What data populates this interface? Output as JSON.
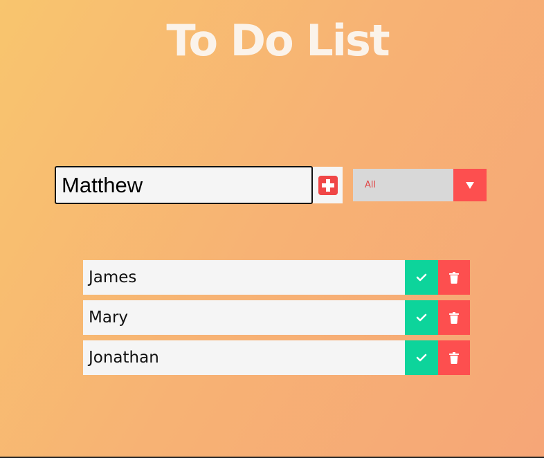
{
  "header": {
    "title": "To Do List"
  },
  "form": {
    "input_value": "Matthew",
    "add_icon": "plus-square-icon"
  },
  "filter": {
    "selected": "All",
    "arrow_icon": "caret-down-icon"
  },
  "todos": [
    {
      "text": "James"
    },
    {
      "text": "Mary"
    },
    {
      "text": "Jonathan"
    }
  ],
  "colors": {
    "check": "#0dd49b",
    "delete": "#fd4f4f",
    "accent": "#f04747",
    "background_start": "#f8c56e",
    "background_end": "#f6a677"
  }
}
